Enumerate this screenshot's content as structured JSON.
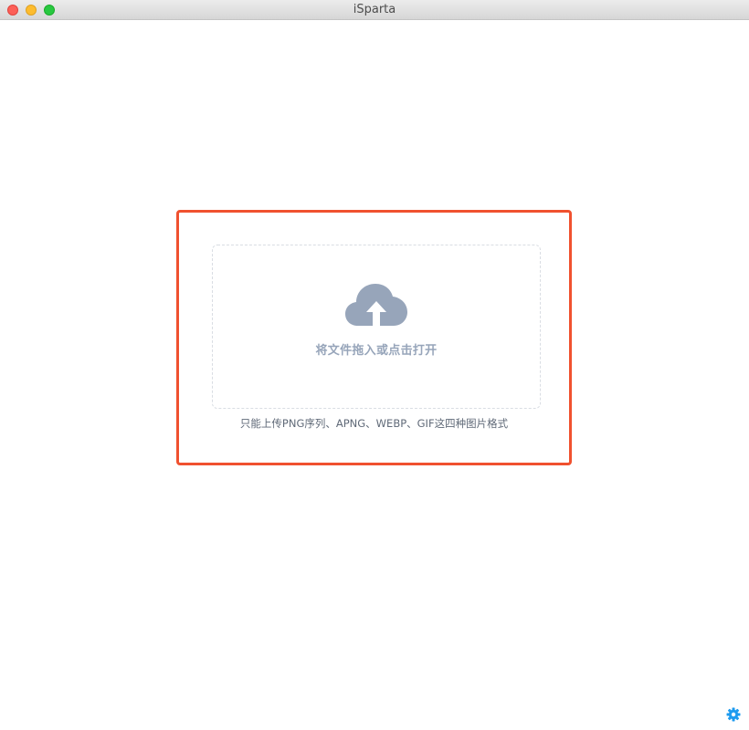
{
  "window": {
    "title": "iSparta"
  },
  "upload": {
    "drop_label": "将文件拖入或点击打开",
    "hint": "只能上传PNG序列、APNG、WEBP、GIF这四种图片格式",
    "icon": "cloud-upload-icon"
  },
  "footer": {
    "settings_icon": "gear-icon"
  },
  "colors": {
    "accent_border": "#f0512f",
    "icon_gray": "#97a5ba",
    "settings_blue": "#1e9bef"
  }
}
